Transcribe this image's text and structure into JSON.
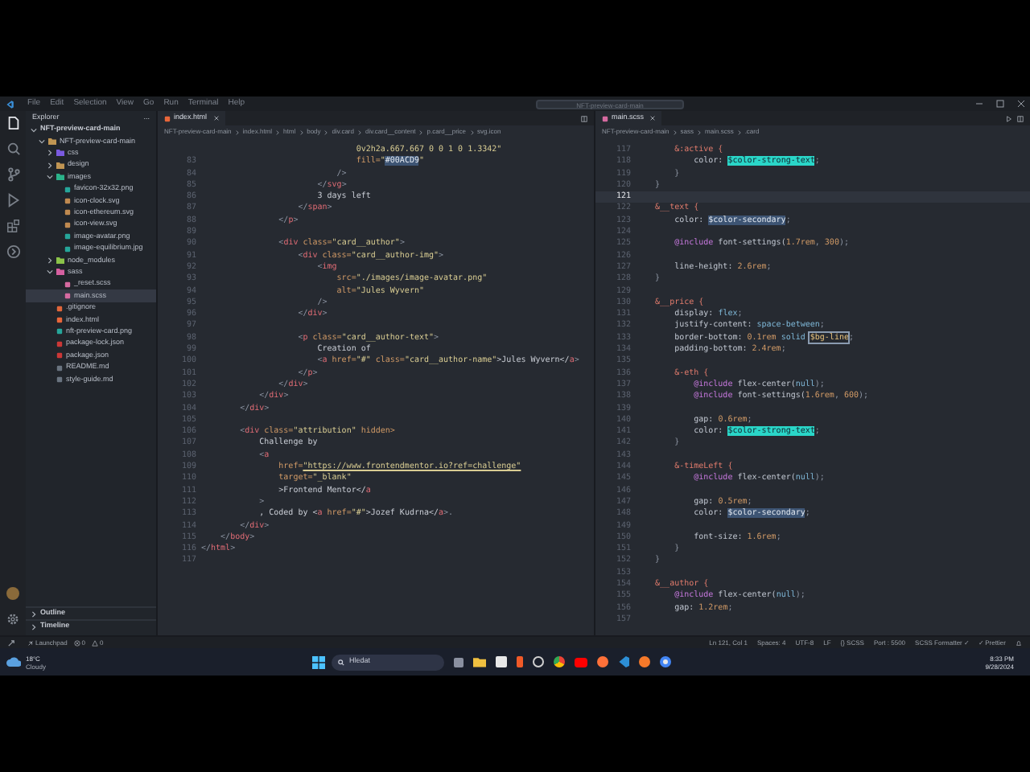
{
  "title_bar": {
    "menu": [
      "File",
      "Edit",
      "Selection",
      "View",
      "Go",
      "Run",
      "Terminal",
      "Help"
    ],
    "search": {
      "value": "NFT-preview-card-main"
    }
  },
  "activity_bar": {
    "items": [
      {
        "kind": "files",
        "selected": true
      },
      {
        "kind": "search",
        "selected": false
      },
      {
        "kind": "source-control",
        "selected": false
      },
      {
        "kind": "debug",
        "selected": false
      },
      {
        "kind": "extensions",
        "selected": false
      },
      {
        "kind": "remote",
        "selected": false
      }
    ]
  },
  "sidebar": {
    "title": "Explorer",
    "more": "...",
    "tree": [
      {
        "label": "NFT-preview-card-main",
        "kind": "root",
        "expanded": true,
        "selected": false,
        "children": [
          {
            "label": "NFT-preview-card-main",
            "kind": "folder",
            "expanded": true,
            "selected": false,
            "children": [
              {
                "label": "css",
                "kind": "folder-css",
                "expanded": false,
                "selected": false
              },
              {
                "label": "design",
                "kind": "folder",
                "expanded": false,
                "selected": false
              },
              {
                "label": "images",
                "kind": "folder-images",
                "expanded": true,
                "selected": false,
                "children": [
                  {
                    "label": "favicon-32x32.png",
                    "kind": "image",
                    "selected": false
                  },
                  {
                    "label": "icon-clock.svg",
                    "kind": "svg",
                    "selected": false
                  },
                  {
                    "label": "icon-ethereum.svg",
                    "kind": "svg",
                    "selected": false
                  },
                  {
                    "label": "icon-view.svg",
                    "kind": "svg",
                    "selected": false
                  },
                  {
                    "label": "image-avatar.png",
                    "kind": "image",
                    "selected": false
                  },
                  {
                    "label": "image-equilibrium.jpg",
                    "kind": "image",
                    "selected": false
                  }
                ]
              },
              {
                "label": "node_modules",
                "kind": "folder-node",
                "expanded": false,
                "selected": false
              },
              {
                "label": "sass",
                "kind": "folder-sass",
                "expanded": true,
                "selected": false,
                "children": [
                  {
                    "label": "_reset.scss",
                    "kind": "scss",
                    "selected": false
                  },
                  {
                    "label": "main.scss",
                    "kind": "scss",
                    "selected": true
                  }
                ]
              },
              {
                "label": ".gitignore",
                "kind": "git",
                "selected": false
              },
              {
                "label": "index.html",
                "kind": "html",
                "selected": false
              },
              {
                "label": "nft-preview-card.png",
                "kind": "image",
                "selected": false
              },
              {
                "label": "package-lock.json",
                "kind": "npm",
                "selected": false
              },
              {
                "label": "package.json",
                "kind": "npm",
                "selected": false
              },
              {
                "label": "README.md",
                "kind": "md",
                "selected": false
              },
              {
                "label": "style-guide.md",
                "kind": "md",
                "selected": false
              }
            ]
          }
        ]
      }
    ],
    "sections": [
      {
        "label": "Outline",
        "expanded": false
      },
      {
        "label": "Timeline",
        "expanded": false
      }
    ]
  },
  "editors": [
    {
      "tab": {
        "label": "index.html",
        "kind": "html",
        "selected": true
      },
      "breadcrumbs": [
        "NFT-preview-card-main",
        "index.html",
        "html",
        "body",
        "div.card",
        "div.card__content",
        "p.card__price",
        "svg.icon"
      ],
      "lines": [
        {
          "segs": [
            {
              "text": "                                0v2h2a.667.667 0 0 1 0 1.3342\"",
              "kind": "str"
            }
          ]
        },
        {
          "n": "83",
          "segs": [
            {
              "text": "                                fill=",
              "kind": "attr"
            },
            {
              "text": "\"",
              "kind": "str"
            },
            {
              "text": "#00ACD9",
              "kind": "hls"
            },
            {
              "text": "\"",
              "kind": "str"
            }
          ]
        },
        {
          "n": "84",
          "segs": [
            {
              "text": "                            />",
              "kind": "pun"
            }
          ]
        },
        {
          "n": "85",
          "segs": [
            {
              "text": "                        </",
              "kind": "pun"
            },
            {
              "text": "svg",
              "kind": "tag"
            },
            {
              "text": ">",
              "kind": "pun"
            }
          ]
        },
        {
          "n": "86",
          "segs": [
            {
              "text": "                        3 days left",
              "kind": "txt"
            }
          ]
        },
        {
          "n": "87",
          "segs": [
            {
              "text": "                    </",
              "kind": "pun"
            },
            {
              "text": "span",
              "kind": "tag"
            },
            {
              "text": ">",
              "kind": "pun"
            }
          ]
        },
        {
          "n": "88",
          "segs": [
            {
              "text": "                </",
              "kind": "pun"
            },
            {
              "text": "p",
              "kind": "tag"
            },
            {
              "text": ">",
              "kind": "pun"
            }
          ]
        },
        {
          "n": "89"
        },
        {
          "n": "90",
          "segs": [
            {
              "text": "                <",
              "kind": "pun"
            },
            {
              "text": "div",
              "kind": "tag"
            },
            {
              "text": " class=",
              "kind": "attr"
            },
            {
              "text": "\"card__author\"",
              "kind": "str"
            },
            {
              "text": ">",
              "kind": "pun"
            }
          ]
        },
        {
          "n": "91",
          "segs": [
            {
              "text": "                    <",
              "kind": "pun"
            },
            {
              "text": "div",
              "kind": "tag"
            },
            {
              "text": " class=",
              "kind": "attr"
            },
            {
              "text": "\"card__author-img\"",
              "kind": "str"
            },
            {
              "text": ">",
              "kind": "pun"
            }
          ]
        },
        {
          "n": "92",
          "segs": [
            {
              "text": "                        <",
              "kind": "pun"
            },
            {
              "text": "img",
              "kind": "tag"
            }
          ]
        },
        {
          "n": "93",
          "segs": [
            {
              "text": "                            src=",
              "kind": "attr"
            },
            {
              "text": "\"./images/image-avatar.png\"",
              "kind": "str"
            }
          ]
        },
        {
          "n": "94",
          "segs": [
            {
              "text": "                            alt=",
              "kind": "attr"
            },
            {
              "text": "\"Jules Wyvern\"",
              "kind": "str"
            }
          ]
        },
        {
          "n": "95",
          "segs": [
            {
              "text": "                        />",
              "kind": "pun"
            }
          ]
        },
        {
          "n": "96",
          "segs": [
            {
              "text": "                    </",
              "kind": "pun"
            },
            {
              "text": "div",
              "kind": "tag"
            },
            {
              "text": ">",
              "kind": "pun"
            }
          ]
        },
        {
          "n": "97"
        },
        {
          "n": "98",
          "segs": [
            {
              "text": "                    <",
              "kind": "pun"
            },
            {
              "text": "p",
              "kind": "tag"
            },
            {
              "text": " class=",
              "kind": "attr"
            },
            {
              "text": "\"card__author-text\"",
              "kind": "str"
            },
            {
              "text": ">",
              "kind": "pun"
            }
          ]
        },
        {
          "n": "99",
          "segs": [
            {
              "text": "                        Creation of",
              "kind": "txt"
            }
          ]
        },
        {
          "n": "100",
          "segs": [
            {
              "text": "                        <",
              "kind": "pun"
            },
            {
              "text": "a",
              "kind": "tag"
            },
            {
              "text": " href=",
              "kind": "attr"
            },
            {
              "text": "\"#\"",
              "kind": "str"
            },
            {
              "text": " class=",
              "kind": "attr"
            },
            {
              "text": "\"card__author-name\"",
              "kind": "str"
            },
            {
              "text": ">Jules Wyvern</",
              "kind": "txt"
            },
            {
              "text": "a",
              "kind": "tag"
            },
            {
              "text": ">",
              "kind": "pun"
            }
          ]
        },
        {
          "n": "101",
          "segs": [
            {
              "text": "                    </",
              "kind": "pun"
            },
            {
              "text": "p",
              "kind": "tag"
            },
            {
              "text": ">",
              "kind": "pun"
            }
          ]
        },
        {
          "n": "102",
          "segs": [
            {
              "text": "                </",
              "kind": "pun"
            },
            {
              "text": "div",
              "kind": "tag"
            },
            {
              "text": ">",
              "kind": "pun"
            }
          ]
        },
        {
          "n": "103",
          "segs": [
            {
              "text": "            </",
              "kind": "pun"
            },
            {
              "text": "div",
              "kind": "tag"
            },
            {
              "text": ">",
              "kind": "pun"
            }
          ]
        },
        {
          "n": "104",
          "segs": [
            {
              "text": "        </",
              "kind": "pun"
            },
            {
              "text": "div",
              "kind": "tag"
            },
            {
              "text": ">",
              "kind": "pun"
            }
          ]
        },
        {
          "n": "105"
        },
        {
          "n": "106",
          "segs": [
            {
              "text": "        <",
              "kind": "pun"
            },
            {
              "text": "div",
              "kind": "tag"
            },
            {
              "text": " class=",
              "kind": "attr"
            },
            {
              "text": "\"attribution\"",
              "kind": "str"
            },
            {
              "text": " hidden>",
              "kind": "attr"
            }
          ]
        },
        {
          "n": "107",
          "segs": [
            {
              "text": "            Challenge by",
              "kind": "txt"
            }
          ]
        },
        {
          "n": "108",
          "segs": [
            {
              "text": "            <",
              "kind": "pun"
            },
            {
              "text": "a",
              "kind": "tag"
            }
          ]
        },
        {
          "n": "109",
          "segs": [
            {
              "text": "                href=",
              "kind": "attr"
            },
            {
              "text": "\"https://www.frontendmentor.io?ref=challenge\"",
              "kind": "url"
            }
          ]
        },
        {
          "n": "110",
          "segs": [
            {
              "text": "                target=",
              "kind": "attr"
            },
            {
              "text": "\"_blank\"",
              "kind": "str"
            }
          ]
        },
        {
          "n": "111",
          "segs": [
            {
              "text": "                >Frontend Mentor</",
              "kind": "txt"
            },
            {
              "text": "a",
              "kind": "tag"
            }
          ]
        },
        {
          "n": "112",
          "segs": [
            {
              "text": "            >",
              "kind": "pun"
            }
          ]
        },
        {
          "n": "113",
          "segs": [
            {
              "text": "            , Coded by <",
              "kind": "txt"
            },
            {
              "text": "a",
              "kind": "tag"
            },
            {
              "text": " href=",
              "kind": "attr"
            },
            {
              "text": "\"#\"",
              "kind": "str"
            },
            {
              "text": ">Jozef Kudrna</",
              "kind": "txt"
            },
            {
              "text": "a",
              "kind": "tag"
            },
            {
              "text": ">.",
              "kind": "pun"
            }
          ]
        },
        {
          "n": "114",
          "segs": [
            {
              "text": "        </",
              "kind": "pun"
            },
            {
              "text": "div",
              "kind": "tag"
            },
            {
              "text": ">",
              "kind": "pun"
            }
          ]
        },
        {
          "n": "115",
          "segs": [
            {
              "text": "    </",
              "kind": "pun"
            },
            {
              "text": "body",
              "kind": "tag"
            },
            {
              "text": ">",
              "kind": "pun"
            }
          ]
        },
        {
          "n": "116",
          "segs": [
            {
              "text": "</",
              "kind": "pun"
            },
            {
              "text": "html",
              "kind": "tag"
            },
            {
              "text": ">",
              "kind": "pun"
            }
          ]
        },
        {
          "n": "117"
        }
      ]
    },
    {
      "tab": {
        "label": "main.scss",
        "kind": "scss",
        "selected": true
      },
      "breadcrumbs": [
        "NFT-preview-card-main",
        "sass",
        "main.scss",
        ".card"
      ],
      "lines": [
        {
          "n": "117",
          "current": false,
          "segs": [
            {
              "text": "        &:active {",
              "kind": "sel"
            }
          ]
        },
        {
          "n": "118",
          "current": false,
          "segs": [
            {
              "text": "            color: ",
              "kind": "prop"
            },
            {
              "text": "$color-strong-text",
              "kind": "hlc"
            },
            {
              "text": ";",
              "kind": "pun"
            }
          ]
        },
        {
          "n": "119",
          "current": false,
          "segs": [
            {
              "text": "        }",
              "kind": "pun"
            }
          ]
        },
        {
          "n": "120",
          "current": false,
          "segs": [
            {
              "text": "    }",
              "kind": "pun"
            }
          ]
        },
        {
          "n": "121",
          "current": true
        },
        {
          "n": "122",
          "current": false,
          "segs": [
            {
              "text": "    &__text {",
              "kind": "sel"
            }
          ]
        },
        {
          "n": "123",
          "current": false,
          "segs": [
            {
              "text": "        color: ",
              "kind": "prop"
            },
            {
              "text": "$color-secondary",
              "kind": "hls"
            },
            {
              "text": ";",
              "kind": "pun"
            }
          ]
        },
        {
          "n": "124",
          "current": false
        },
        {
          "n": "125",
          "current": false,
          "segs": [
            {
              "text": "        @include",
              "kind": "at"
            },
            {
              "text": " font-settings(",
              "kind": "fn"
            },
            {
              "text": "1.7rem",
              "kind": "num"
            },
            {
              "text": ", ",
              "kind": "pun"
            },
            {
              "text": "300",
              "kind": "num"
            },
            {
              "text": ");",
              "kind": "pun"
            }
          ]
        },
        {
          "n": "126",
          "current": false
        },
        {
          "n": "127",
          "current": false,
          "segs": [
            {
              "text": "        line-height: ",
              "kind": "prop"
            },
            {
              "text": "2.6rem",
              "kind": "num"
            },
            {
              "text": ";",
              "kind": "pun"
            }
          ]
        },
        {
          "n": "128",
          "current": false,
          "segs": [
            {
              "text": "    }",
              "kind": "pun"
            }
          ]
        },
        {
          "n": "129",
          "current": false
        },
        {
          "n": "130",
          "current": false,
          "segs": [
            {
              "text": "    &__price {",
              "kind": "sel"
            }
          ]
        },
        {
          "n": "131",
          "current": false,
          "segs": [
            {
              "text": "        display: ",
              "kind": "prop"
            },
            {
              "text": "flex",
              "kind": "kw"
            },
            {
              "text": ";",
              "kind": "pun"
            }
          ]
        },
        {
          "n": "132",
          "current": false,
          "segs": [
            {
              "text": "        justify-content: ",
              "kind": "prop"
            },
            {
              "text": "space-between",
              "kind": "kw"
            },
            {
              "text": ";",
              "kind": "pun"
            }
          ]
        },
        {
          "n": "133",
          "current": false,
          "segs": [
            {
              "text": "        border-bottom: ",
              "kind": "prop"
            },
            {
              "text": "0.1rem",
              "kind": "num"
            },
            {
              "text": " solid ",
              "kind": "kw"
            },
            {
              "text": "$bg-line",
              "kind": "hlb"
            },
            {
              "text": ";",
              "kind": "pun"
            }
          ]
        },
        {
          "n": "134",
          "current": false,
          "segs": [
            {
              "text": "        padding-bottom: ",
              "kind": "prop"
            },
            {
              "text": "2.4rem",
              "kind": "num"
            },
            {
              "text": ";",
              "kind": "pun"
            }
          ]
        },
        {
          "n": "135",
          "current": false
        },
        {
          "n": "136",
          "current": false,
          "segs": [
            {
              "text": "        &-eth {",
              "kind": "sel"
            }
          ]
        },
        {
          "n": "137",
          "current": false,
          "segs": [
            {
              "text": "            @include",
              "kind": "at"
            },
            {
              "text": " flex-center(",
              "kind": "fn"
            },
            {
              "text": "null",
              "kind": "kw"
            },
            {
              "text": ");",
              "kind": "pun"
            }
          ]
        },
        {
          "n": "138",
          "current": false,
          "segs": [
            {
              "text": "            @include",
              "kind": "at"
            },
            {
              "text": " font-settings(",
              "kind": "fn"
            },
            {
              "text": "1.6rem",
              "kind": "num"
            },
            {
              "text": ", ",
              "kind": "pun"
            },
            {
              "text": "600",
              "kind": "num"
            },
            {
              "text": ");",
              "kind": "pun"
            }
          ]
        },
        {
          "n": "139",
          "current": false
        },
        {
          "n": "140",
          "current": false,
          "segs": [
            {
              "text": "            gap: ",
              "kind": "prop"
            },
            {
              "text": "0.6rem",
              "kind": "num"
            },
            {
              "text": ";",
              "kind": "pun"
            }
          ]
        },
        {
          "n": "141",
          "current": false,
          "segs": [
            {
              "text": "            color: ",
              "kind": "prop"
            },
            {
              "text": "$color-strong-text",
              "kind": "hlc"
            },
            {
              "text": ";",
              "kind": "pun"
            }
          ]
        },
        {
          "n": "142",
          "current": false,
          "segs": [
            {
              "text": "        }",
              "kind": "pun"
            }
          ]
        },
        {
          "n": "143",
          "current": false
        },
        {
          "n": "144",
          "current": false,
          "segs": [
            {
              "text": "        &-timeLeft {",
              "kind": "sel"
            }
          ]
        },
        {
          "n": "145",
          "current": false,
          "segs": [
            {
              "text": "            @include",
              "kind": "at"
            },
            {
              "text": " flex-center(",
              "kind": "fn"
            },
            {
              "text": "null",
              "kind": "kw"
            },
            {
              "text": ");",
              "kind": "pun"
            }
          ]
        },
        {
          "n": "146",
          "current": false
        },
        {
          "n": "147",
          "current": false,
          "segs": [
            {
              "text": "            gap: ",
              "kind": "prop"
            },
            {
              "text": "0.5rem",
              "kind": "num"
            },
            {
              "text": ";",
              "kind": "pun"
            }
          ]
        },
        {
          "n": "148",
          "current": false,
          "segs": [
            {
              "text": "            color: ",
              "kind": "prop"
            },
            {
              "text": "$color-secondary",
              "kind": "hls"
            },
            {
              "text": ";",
              "kind": "pun"
            }
          ]
        },
        {
          "n": "149",
          "current": false
        },
        {
          "n": "150",
          "current": false,
          "segs": [
            {
              "text": "            font-size: ",
              "kind": "prop"
            },
            {
              "text": "1.6rem",
              "kind": "num"
            },
            {
              "text": ";",
              "kind": "pun"
            }
          ]
        },
        {
          "n": "151",
          "current": false,
          "segs": [
            {
              "text": "        }",
              "kind": "pun"
            }
          ]
        },
        {
          "n": "152",
          "current": false,
          "segs": [
            {
              "text": "    }",
              "kind": "pun"
            }
          ]
        },
        {
          "n": "153",
          "current": false
        },
        {
          "n": "154",
          "current": false,
          "segs": [
            {
              "text": "    &__author {",
              "kind": "sel"
            }
          ]
        },
        {
          "n": "155",
          "current": false,
          "segs": [
            {
              "text": "        @include",
              "kind": "at"
            },
            {
              "text": " flex-center(",
              "kind": "fn"
            },
            {
              "text": "null",
              "kind": "kw"
            },
            {
              "text": ");",
              "kind": "pun"
            }
          ]
        },
        {
          "n": "156",
          "current": false,
          "segs": [
            {
              "text": "        gap: ",
              "kind": "prop"
            },
            {
              "text": "1.2rem",
              "kind": "num"
            },
            {
              "text": ";",
              "kind": "pun"
            }
          ]
        },
        {
          "n": "157",
          "current": false
        }
      ]
    }
  ],
  "status_bar": {
    "left": [
      {
        "kind": "launchpad",
        "text": "Launchpad"
      },
      {
        "kind": "errors",
        "text": "0"
      },
      {
        "kind": "warnings",
        "text": "0"
      }
    ],
    "right": [
      "Ln 121, Col 1",
      "Spaces: 4",
      "UTF-8",
      "LF",
      "{} SCSS",
      "Port : 5500",
      "SCSS Formatter ✓",
      "✓ Prettier"
    ]
  },
  "taskbar": {
    "weather": {
      "temperature": "18°C",
      "condition": "Cloudy"
    },
    "search": {
      "placeholder": "Hledat"
    },
    "time": "8:33 PM",
    "date": "9/28/2024"
  }
}
